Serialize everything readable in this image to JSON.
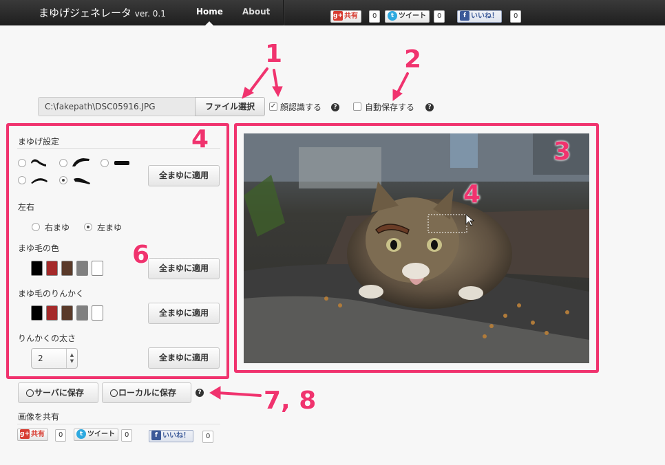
{
  "header": {
    "brand": "まゆげジェネレータ",
    "version": "ver. 0.1",
    "nav": [
      {
        "label": "Home",
        "active": true
      },
      {
        "label": "About",
        "active": false
      }
    ],
    "social": {
      "google_label": "共有",
      "google_count": "0",
      "tweet_label": "ツイート",
      "tweet_count": "0",
      "like_label": "いいね！",
      "like_count": "0"
    }
  },
  "file": {
    "path": "C:\\fakepath\\DSC05916.JPG",
    "select_button": "ファイル選択",
    "face_detect_label": "顔認識する",
    "face_detect_checked": true,
    "autosave_label": "自動保存する",
    "autosave_checked": false
  },
  "settings": {
    "title": "まゆげ設定",
    "apply_label": "全まゆに適用",
    "eyebrow_shapes": [
      "shape-1",
      "shape-2",
      "shape-3",
      "shape-4",
      "shape-5"
    ],
    "selected_shape": 5,
    "side_title": "左右",
    "side_right": "右まゆ",
    "side_left": "左まゆ",
    "side_selected": "left",
    "color_title": "まゆ毛の色",
    "outline_title": "まゆ毛のりんかく",
    "colors": [
      "#000000",
      "#a52a2a",
      "#5a3a2a",
      "#808080",
      "#ffffff"
    ],
    "thickness_title": "りんかくの太さ",
    "thickness_value": "2"
  },
  "actions": {
    "save_server": "サーバに保存",
    "save_local": "ローカルに保存"
  },
  "share": {
    "title": "画像を共有",
    "google_label": "共有",
    "google_count": "0",
    "tweet_label": "ツイート",
    "tweet_count": "0",
    "like_label": "いいね！",
    "like_count": "0"
  },
  "annotations": [
    "1",
    "2",
    "3",
    "4",
    "4",
    "6",
    "7, 8"
  ],
  "colors": {
    "accent": "#f0336e",
    "navbar": "#2b2b2b"
  }
}
